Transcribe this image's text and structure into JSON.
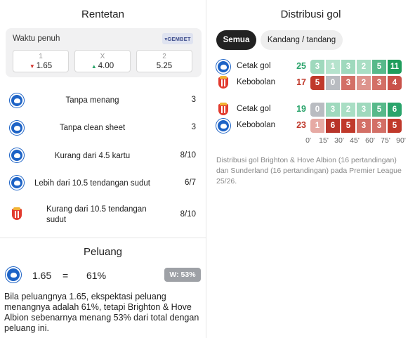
{
  "rentetan": {
    "title": "Rentetan",
    "odds": {
      "label": "Waktu penuh",
      "bookie": "GEMBET",
      "items": [
        {
          "label": "1",
          "value": "1.65",
          "trend": "down"
        },
        {
          "label": "X",
          "value": "4.00",
          "trend": "up"
        },
        {
          "label": "2",
          "value": "5.25",
          "trend": ""
        }
      ]
    },
    "streaks": [
      {
        "team": "brighton",
        "text": "Tanpa menang",
        "value": "3"
      },
      {
        "team": "brighton",
        "text": "Tanpa clean sheet",
        "value": "3"
      },
      {
        "team": "brighton",
        "text": "Kurang dari 4.5 kartu",
        "value": "8/10"
      },
      {
        "team": "brighton",
        "text": "Lebih dari 10.5 tendangan sudut",
        "value": "6/7"
      },
      {
        "team": "sunderland",
        "text": "Kurang dari 10.5 tendangan sudut",
        "value": "8/10"
      }
    ]
  },
  "peluang": {
    "title": "Peluang",
    "odd": "1.65",
    "eq": "=",
    "percent": "61%",
    "badge": "W: 53%",
    "description": "Bila peluangnya 1.65, ekspektasi peluang menangnya adalah 61%, tetapi Brighton & Hove Albion sebenarnya menang 53% dari total dengan peluang ini."
  },
  "distribusi": {
    "title": "Distribusi gol",
    "tabs": [
      "Semua",
      "Kandang / tandang"
    ],
    "colors": {
      "scored": "#2aa46b",
      "conceded": "#c0392b"
    },
    "groups": [
      {
        "team": "brighton",
        "rows": [
          {
            "label": "Cetak gol",
            "total": "25",
            "kind": "scored",
            "cells": [
              "3",
              "1",
              "3",
              "2",
              "5",
              "11"
            ],
            "shades": [
              "#9fd9bd",
              "#b6e3cd",
              "#9fd9bd",
              "#a9dec4",
              "#57b98a",
              "#1f9d5c"
            ]
          },
          {
            "label": "Kebobolan",
            "total": "17",
            "kind": "conceded",
            "cells": [
              "5",
              "0",
              "3",
              "2",
              "3",
              "4"
            ],
            "shades": [
              "#c0392b",
              "#b9bcc1",
              "#d36f66",
              "#dd948d",
              "#d36f66",
              "#c9524a"
            ]
          }
        ]
      },
      {
        "team": "sunderland",
        "rows": [
          {
            "label": "Cetak gol",
            "total": "19",
            "kind": "scored",
            "cells": [
              "0",
              "3",
              "2",
              "3",
              "5",
              "6"
            ],
            "shades": [
              "#b9bcc1",
              "#9fd9bd",
              "#a9dec4",
              "#9fd9bd",
              "#57b98a",
              "#2aa46b"
            ]
          },
          {
            "label": "Kebobolan",
            "total": "23",
            "kind": "conceded",
            "cells": [
              "1",
              "6",
              "5",
              "3",
              "3",
              "5"
            ],
            "shades": [
              "#e6aaa4",
              "#b8342a",
              "#c0392b",
              "#d36f66",
              "#d36f66",
              "#c0392b"
            ]
          }
        ]
      }
    ],
    "ticks": [
      "0'",
      "15'",
      "30'",
      "45'",
      "60'",
      "75'",
      "90'"
    ],
    "note": "Distribusi gol Brighton & Hove Albion (16 pertandingan) dan Sunderland (16 pertandingan) pada Premier League 25/26."
  }
}
